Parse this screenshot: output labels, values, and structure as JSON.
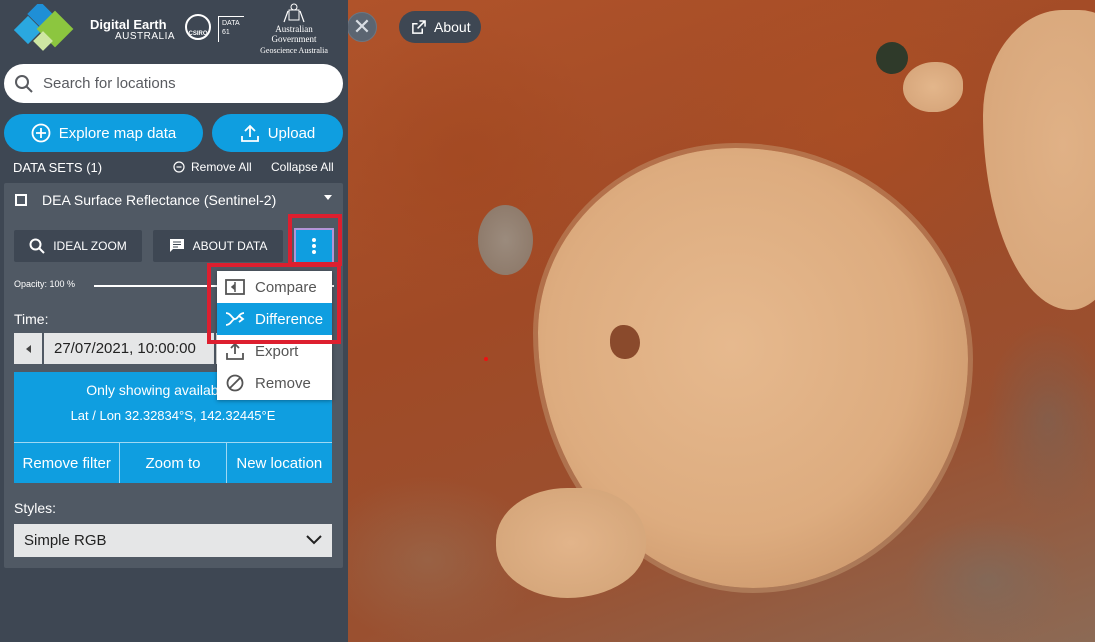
{
  "brand": {
    "title": "Digital Earth",
    "subtitle": "AUSTRALIA",
    "csiro": "CSIRO",
    "data61_line1": "DATA",
    "data61_line2": "61",
    "gov_name": "Australian Government",
    "gov_dept": "Geoscience Australia"
  },
  "search": {
    "placeholder": "Search for locations",
    "icon": "search-icon"
  },
  "actions": {
    "explore": "Explore map data",
    "upload": "Upload"
  },
  "datasets": {
    "title": "DATA SETS (1)",
    "remove_all": "Remove All",
    "collapse_all": "Collapse All"
  },
  "dataset": {
    "name": "DEA Surface Reflectance (Sentinel-2)",
    "ideal_zoom": "IDEAL ZOOM",
    "about_data": "ABOUT DATA",
    "opacity_label": "Opacity: 100 %",
    "opacity": 1.0,
    "time_label": "Time:",
    "time_value": "27/07/2021, 10:00:00",
    "filter_message": "Only showing available capt",
    "filter_coords": "Lat / Lon 32.32834°S, 142.32445°E",
    "filter_actions": [
      "Remove filter",
      "Zoom to",
      "New location"
    ],
    "styles_label": "Styles:",
    "style_value": "Simple RGB"
  },
  "menu": {
    "items": [
      {
        "label": "Compare",
        "icon": "compare-icon"
      },
      {
        "label": "Difference",
        "icon": "difference-icon",
        "selected": true
      },
      {
        "label": "Export",
        "icon": "export-icon"
      },
      {
        "label": "Remove",
        "icon": "remove-icon"
      }
    ]
  },
  "map": {
    "about_label": "About",
    "close_glyph": "✕"
  },
  "colors": {
    "sidebar": "#3e4753",
    "card": "#505964",
    "accent": "#0f9ee0",
    "highlight": "#dd1f2f"
  }
}
